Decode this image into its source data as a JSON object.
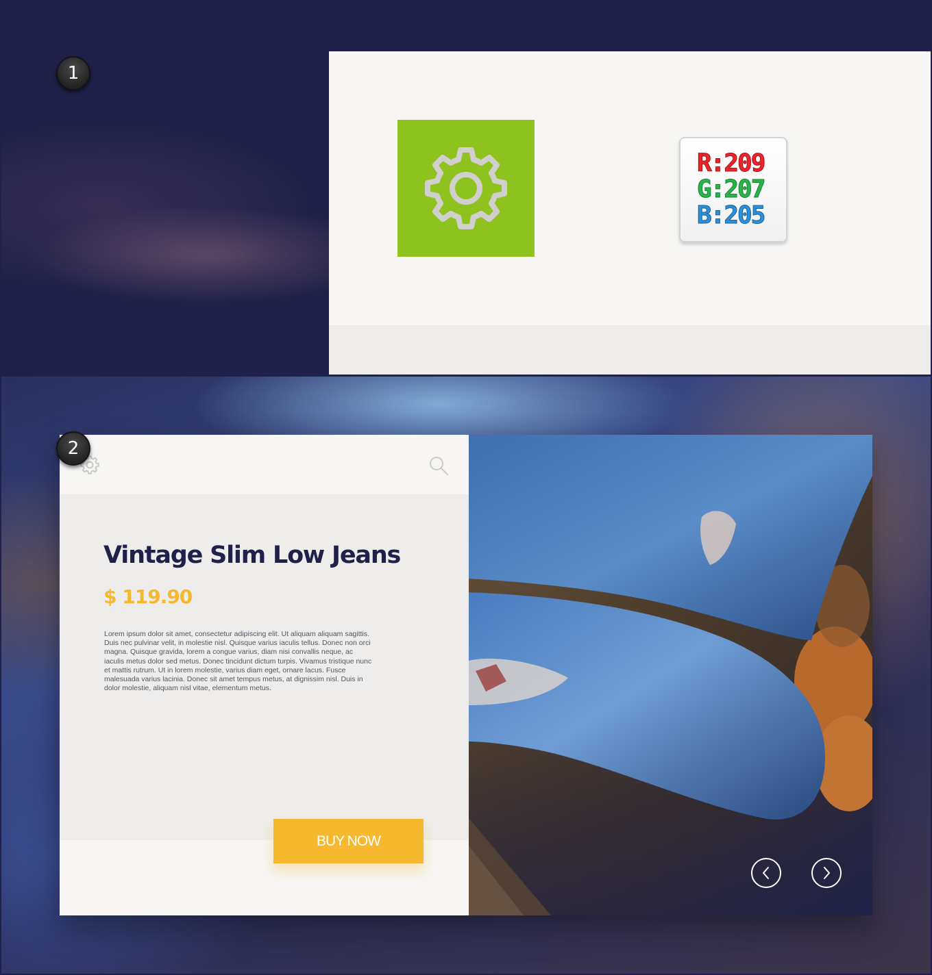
{
  "steps": {
    "step1_number": "1",
    "step2_number": "2"
  },
  "color_swatch": {
    "tile_color": "#8dc21f",
    "gear_color": "#d1cfcd",
    "r_label": "R:209",
    "g_label": "G:207",
    "b_label": "B:205"
  },
  "product": {
    "title": "Vintage Slim Low Jeans",
    "price": "$ 119.90",
    "description": "Lorem ipsum dolor sit amet, consectetur adipiscing elit. Ut aliquam aliquam sagittis. Duis nec pulvinar velit, in molestie nisl. Quisque varius iaculis tellus. Donec non orci magna. Quisque gravida, lorem a congue varius, diam nisi convallis neque, ac iaculis metus dolor sed metus. Donec tincidunt dictum turpis. Vivamus tristique nunc et mattis rutrum. Ut in lorem molestie, varius diam eget, ornare lacus. Fusce malesuada varius lacinia. Donec sit amet tempus metus, at dignissim nisl. Duis in dolor molestie, aliquam nisl vitae, elementum metus.",
    "buy_label": "BUY NOW"
  },
  "colors": {
    "navy": "#20214a",
    "accent_yellow": "#f5b82e",
    "panel_light": "#f7f6f4",
    "panel_gray": "#eeedeb"
  },
  "icons": {
    "settings": "gear-icon",
    "search": "search-icon",
    "previous": "chevron-left-icon",
    "next": "chevron-right-icon"
  }
}
